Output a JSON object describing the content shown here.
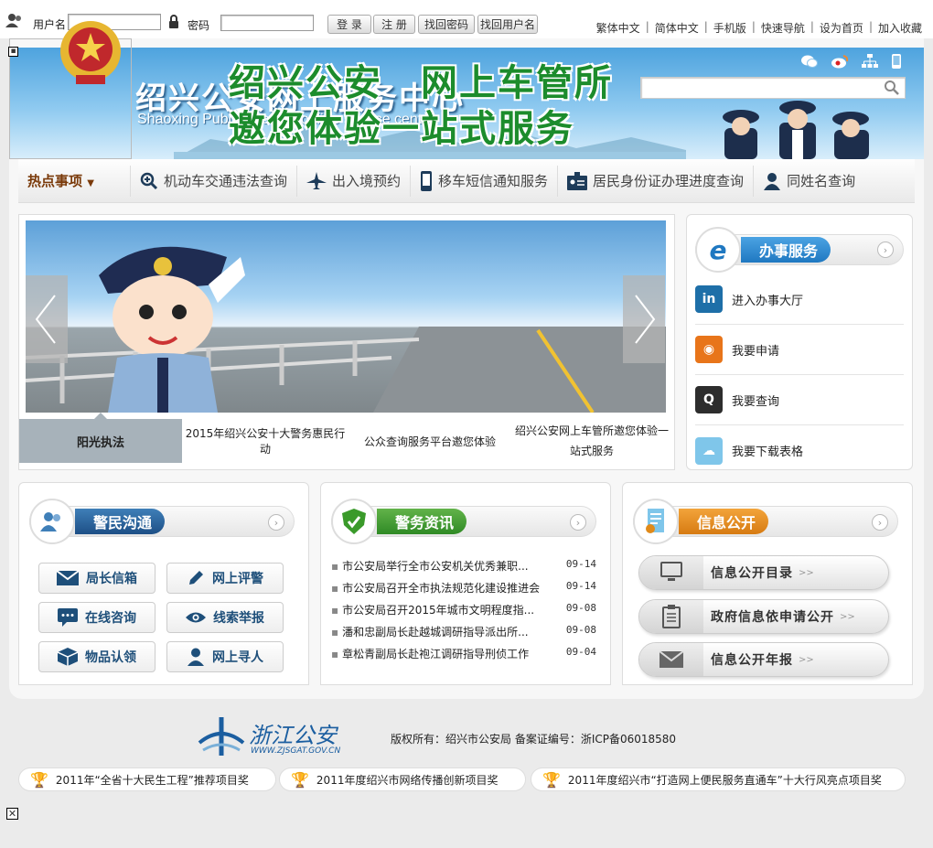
{
  "login": {
    "username_label": "用户名",
    "password_label": "密码",
    "username_value": "",
    "password_value": "",
    "buttons": [
      "登 录",
      "注 册",
      "找回密码",
      "找回用户名"
    ]
  },
  "top_links": [
    "繁体中文",
    "简体中文",
    "手机版",
    "快速导航",
    "设为首页",
    "加入收藏"
  ],
  "banner": {
    "title": "绍兴公安网上服务中心",
    "subtitle": "Shaoxing Public security online service center",
    "search_value": ""
  },
  "nav": {
    "hot": "热点事项",
    "items": [
      "机动车交通违法查询",
      "出入境预约",
      "移车短信通知服务",
      "居民身份证办理进度查询",
      "同姓名查询"
    ]
  },
  "slider": {
    "line1": "绍兴公安　网上车管所",
    "line2": "邀您体验一站式服务",
    "captions": [
      "阳光执法",
      "2015年绍兴公安十大警务惠民行动",
      "公众查询服务平台邀您体验",
      "绍兴公安网上车管所邀您体验一站式服务"
    ]
  },
  "service": {
    "title": "办事服务",
    "items": [
      "进入办事大厅",
      "我要申请",
      "我要查询",
      "我要下载表格"
    ]
  },
  "police": {
    "title": "警民沟通",
    "buttons": [
      "局长信箱",
      "网上评警",
      "在线咨询",
      "线索举报",
      "物品认领",
      "网上寻人"
    ]
  },
  "news": {
    "title": "警务资讯",
    "items": [
      {
        "title": "市公安局举行全市公安机关优秀兼职...",
        "date": "09-14"
      },
      {
        "title": "市公安局召开全市执法规范化建设推进会",
        "date": "09-14"
      },
      {
        "title": "市公安局召开2015年城市文明程度指...",
        "date": "09-08"
      },
      {
        "title": "潘和忠副局长赴越城调研指导派出所...",
        "date": "09-08"
      },
      {
        "title": "章松青副局长赴袍江调研指导刑侦工作",
        "date": "09-04"
      }
    ]
  },
  "info": {
    "title": "信息公开",
    "buttons": [
      "信息公开目录",
      "政府信息依申请公开",
      "信息公开年报"
    ],
    "arrow": ">>"
  },
  "footer": {
    "logo_text": "浙江公安",
    "logo_url": "WWW.ZJSGAT.GOV.CN",
    "copyright": "版权所有：绍兴市公安局  备案证编号：浙ICP备06018580",
    "awards": [
      "2011年“全省十大民生工程”推荐项目奖",
      "2011年度绍兴市网络传播创新项目奖",
      "2011年度绍兴市“打造网上便民服务直通车”十大行风亮点项目奖"
    ]
  },
  "colors": {
    "accent_blue": "#2a7fc4",
    "green": "#3a9a2a",
    "orange": "#e08a1a",
    "nav_hot": "#7a3a0a"
  }
}
